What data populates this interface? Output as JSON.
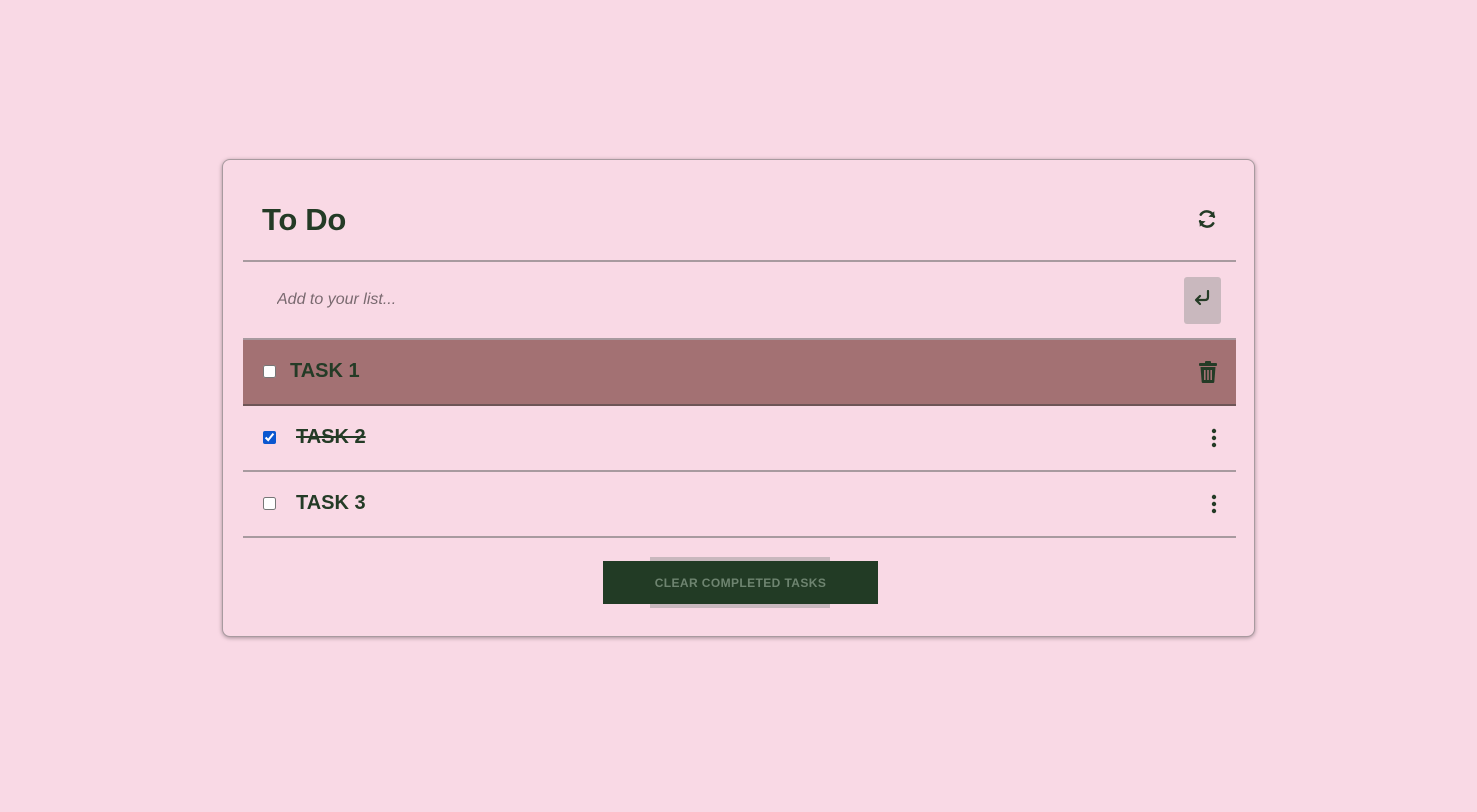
{
  "app": {
    "title": "To Do"
  },
  "add": {
    "placeholder": "Add to your list..."
  },
  "tasks": [
    {
      "label": "TASK 1",
      "completed": false,
      "active": true
    },
    {
      "label": "TASK 2",
      "completed": true,
      "active": false
    },
    {
      "label": "TASK 3",
      "completed": false,
      "active": false
    }
  ],
  "footer": {
    "clear_label": "CLEAR COMPLETED TASKS"
  },
  "icons": {
    "refresh": "refresh-icon",
    "enter": "enter-icon",
    "trash": "trash-icon",
    "more": "more-vertical-icon"
  },
  "colors": {
    "background": "#f9d9e5",
    "text": "#243b26",
    "active_row": "#a37173",
    "button": "#223b25",
    "enter_button": "#c9b8be",
    "checkbox_checked": "#0b57d0"
  }
}
